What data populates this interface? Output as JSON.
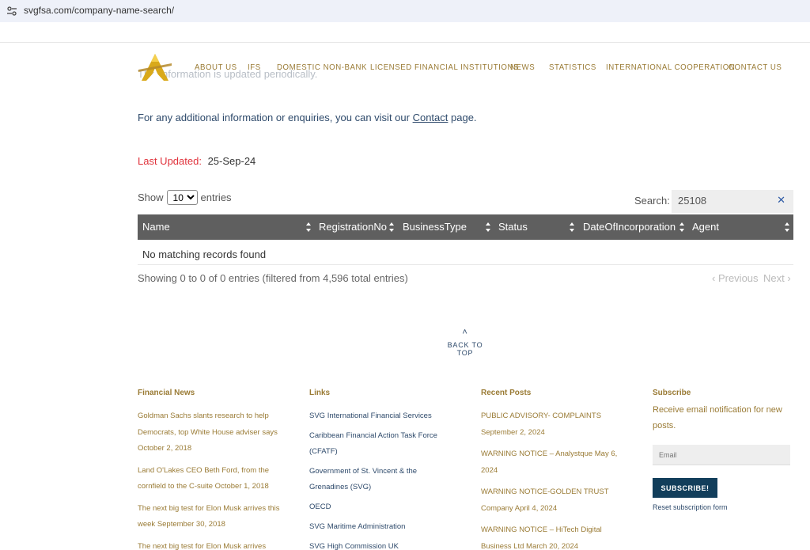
{
  "browser": {
    "url": "svgfsa.com/company-name-search/",
    "icon": "site-settings-icon"
  },
  "nav": {
    "items": [
      "ABOUT US",
      "IFS",
      "DOMESTIC NON-BANK",
      "LICENSED FINANCIAL INSTITUTIONS",
      "NEWS",
      "STATISTICS",
      "INTERNATIONAL COOPERATION",
      "CONTACT US"
    ]
  },
  "content": {
    "faded_text": "This information is updated periodically.",
    "para_prefix": "For any additional information or enquiries, you can visit our ",
    "para_link": "Contact",
    "para_suffix": " page.",
    "last_updated_label": "Last Updated:",
    "last_updated_value": "25-Sep-24"
  },
  "table": {
    "show_label": "Show",
    "entries_label": "entries",
    "page_size": "10",
    "search_label": "Search:",
    "search_value": "25108",
    "columns": [
      "Name",
      "RegistrationNo",
      "BusinessType",
      "Status",
      "DateOfIncorporation",
      "Agent"
    ],
    "empty_message": "No matching records found",
    "info": "Showing 0 to 0 of 0 entries (filtered from 4,596 total entries)",
    "prev": "Previous",
    "next": "Next"
  },
  "back_to_top": "BACK TO TOP",
  "footer": {
    "financial_news": {
      "title": "Financial News",
      "items": [
        "Goldman Sachs slants research to help Democrats, top White House adviser says October 2, 2018",
        "Land O'Lakes CEO Beth Ford, from the cornfield to the C-suite October 1, 2018",
        "The next big test for Elon Musk arrives this week September 30, 2018",
        "The next big test for Elon Musk arrives"
      ]
    },
    "links": {
      "title": "Links",
      "items": [
        "SVG International Financial Services",
        "Caribbean Financial Action Task Force (CFATF)",
        "Government of St. Vincent & the Grenadines (SVG)",
        "OECD",
        "SVG Maritime Administration",
        "SVG High Commission UK"
      ]
    },
    "recent_posts": {
      "title": "Recent Posts",
      "items": [
        "PUBLIC ADVISORY- COMPLAINTS September 2, 2024",
        "WARNING NOTICE – Analystque May 6, 2024",
        "WARNING NOTICE-GOLDEN TRUST Company April 4, 2024",
        "WARNING NOTICE – HiTech Digital Business Ltd March 20, 2024"
      ]
    },
    "subscribe": {
      "title": "Subscribe",
      "text": "Receive email notification for new posts.",
      "email_placeholder": "Email",
      "button": "SUBSCRIBE!",
      "reset": "Reset subscription form"
    }
  },
  "colors": {
    "gold": "#9a7b35",
    "navy": "#2e4a6b",
    "header_bg": "#5f5f5f",
    "button_bg": "#123e5b",
    "red": "#e0333c"
  }
}
